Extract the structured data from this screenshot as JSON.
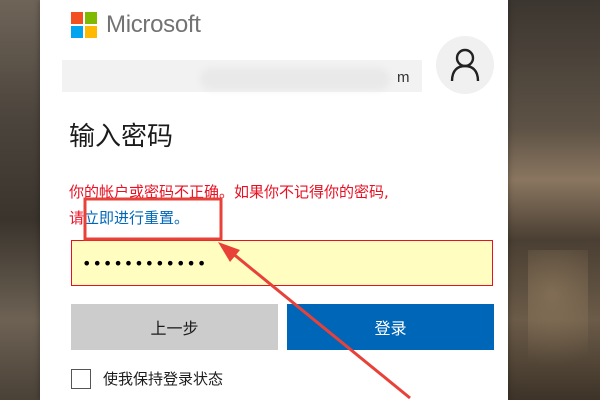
{
  "brand": {
    "name": "Microsoft",
    "logo_colors": [
      "#f25022",
      "#7fba00",
      "#00a4ef",
      "#ffb900"
    ]
  },
  "account": {
    "email_visible_suffix": "m",
    "avatar_icon": "person-icon"
  },
  "page": {
    "title": "输入密码"
  },
  "error": {
    "message_line1": "你的帐户或密码不正确。如果你不记得你的密码,",
    "message_prefix": "请",
    "reset_link": "立即进行重置。",
    "color": "#e81123"
  },
  "password": {
    "value": "••••••••••••"
  },
  "buttons": {
    "back": "上一步",
    "signin": "登录",
    "signin_color": "#0067b8"
  },
  "keep_signed_in": {
    "label": "使我保持登录状态",
    "checked": false
  },
  "annotation": {
    "color": "#e8413a"
  }
}
